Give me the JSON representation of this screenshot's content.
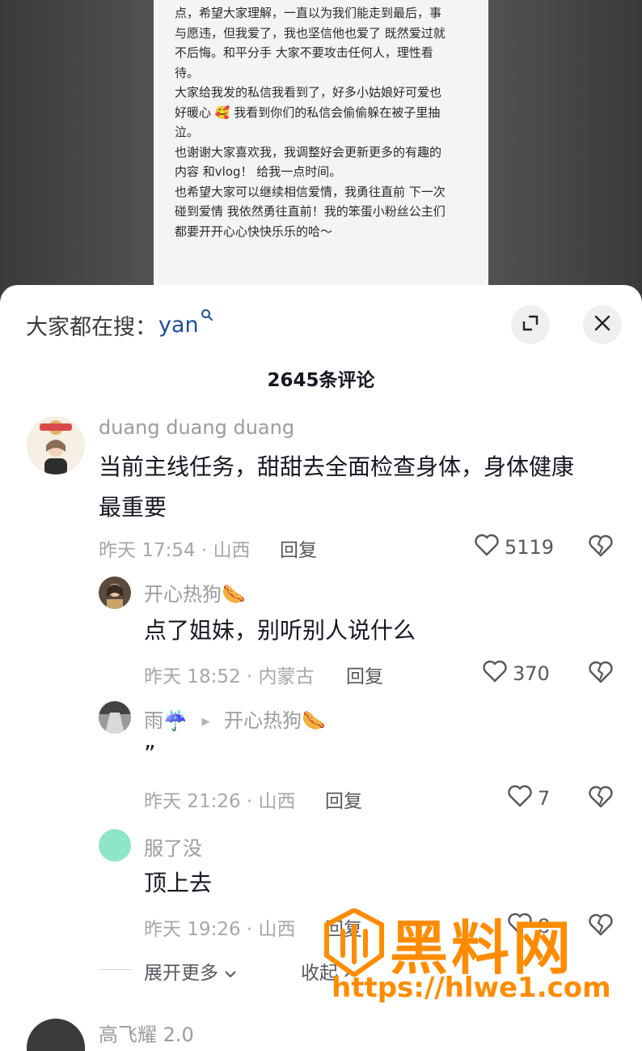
{
  "video": {
    "lines": [
      "点，希望大家理解，一直以为我们能走到最后，事",
      "与愿违，但我爱了，我也坚信他也爱了 既然爱过就",
      "不后悔。和平分手 大家不要攻击任何人，理性看",
      "待。",
      "大家给我发的私信我看到了，好多小姑娘好可爱也",
      "好暖心 🥰 我看到你们的私信会偷偷躲在被子里抽",
      "泣。",
      "也谢谢大家喜欢我，我调整好会更新更多的有趣的",
      "内容 和vlog！ 给我一点时间。",
      "也希望大家可以继续相信爱情，我勇往直前 下一次",
      "碰到爱情 我依然勇往直前！我的笨蛋小粉丝公主们",
      "都要开开心心快快乐乐的哈～"
    ]
  },
  "header": {
    "search_prefix": "大家都在搜：",
    "search_keyword": "yan",
    "comment_count": "2645条评论"
  },
  "comments": [
    {
      "user": "duang duang duang",
      "text_line1": "当前主线任务，甜甜去全面检查身体，身体健康",
      "text_line2": "最重要",
      "meta": "昨天 17:54 · 山西",
      "reply_label": "回复",
      "likes": "5119"
    },
    {
      "user": "开心热狗🌭",
      "text": "点了姐妹，别听别人说什么",
      "meta": "昨天 18:52 · 内蒙古",
      "reply_label": "回复",
      "likes": "370"
    },
    {
      "user": "雨☔️",
      "reply_to": "开心热狗🌭",
      "text": "”",
      "meta": "昨天 21:26 · 山西",
      "reply_label": "回复",
      "likes": "7"
    },
    {
      "user": "服了没",
      "text": "顶上去",
      "meta": "昨天 19:26 · 山西",
      "reply_label": "回复",
      "likes": "8"
    }
  ],
  "thread_controls": {
    "expand_more": "展开更多",
    "collapse": "收起"
  },
  "next_comment": {
    "user": "高飞耀 2.0"
  },
  "watermark": {
    "brand": "黑料网",
    "url": "https://hlwe1.com"
  },
  "colors": {
    "accent_link": "#1d4e9c",
    "watermark_orange": "#ff8c00",
    "meta_gray": "#a7a7ab"
  }
}
